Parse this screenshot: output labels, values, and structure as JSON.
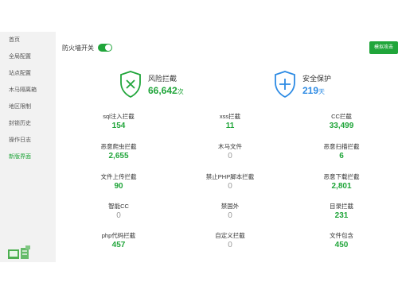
{
  "sidebar": {
    "items": [
      {
        "label": "首页"
      },
      {
        "label": "全局配置"
      },
      {
        "label": "站点配置"
      },
      {
        "label": "木马隔离箱"
      },
      {
        "label": "地区限制"
      },
      {
        "label": "封锁历史"
      },
      {
        "label": "操作日志"
      },
      {
        "label": "新版界面"
      }
    ],
    "active_index": 7
  },
  "topbar": {
    "firewall_label": "防火墙开关",
    "firewall_on": true,
    "attack_button_label": "模拟攻击"
  },
  "summary": {
    "risk": {
      "label": "风险拦截",
      "value": "66,642",
      "unit": "次",
      "icon": "shield-check-icon"
    },
    "safe": {
      "label": "安全保护",
      "value": "219",
      "unit": "天",
      "icon": "shield-plus-icon"
    }
  },
  "stats": [
    [
      {
        "label": "sql注入拦截",
        "value": "154",
        "highlight": true
      },
      {
        "label": "xss拦截",
        "value": "11",
        "highlight": true
      },
      {
        "label": "CC拦截",
        "value": "33,499",
        "highlight": true
      }
    ],
    [
      {
        "label": "恶意爬虫拦截",
        "value": "2,655",
        "highlight": true
      },
      {
        "label": "木马文件",
        "value": "0",
        "highlight": false
      },
      {
        "label": "恶意扫描拦截",
        "value": "6",
        "highlight": true
      }
    ],
    [
      {
        "label": "文件上传拦截",
        "value": "90",
        "highlight": true
      },
      {
        "label": "禁止PHP脚本拦截",
        "value": "0",
        "highlight": false
      },
      {
        "label": "恶意下载拦截",
        "value": "2,801",
        "highlight": true
      }
    ],
    [
      {
        "label": "智能CC",
        "value": "0",
        "highlight": false
      },
      {
        "label": "禁国外",
        "value": "0",
        "highlight": false
      },
      {
        "label": "目录拦截",
        "value": "231",
        "highlight": true
      }
    ],
    [
      {
        "label": "php代码拦截",
        "value": "457",
        "highlight": true
      },
      {
        "label": "自定义拦截",
        "value": "0",
        "highlight": false
      },
      {
        "label": "文件包含",
        "value": "450",
        "highlight": true
      }
    ]
  ],
  "colors": {
    "accent_green": "#20a53a",
    "accent_blue": "#2d8be4",
    "zero_gray": "#999999"
  }
}
